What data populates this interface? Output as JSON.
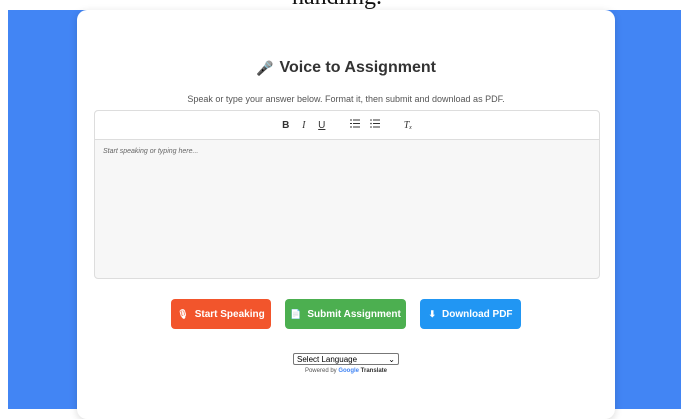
{
  "top_strip_text": "handling.",
  "app": {
    "title": "Voice to Assignment",
    "subtitle": "Speak or type your answer below. Format it, then submit and download as PDF.",
    "title_icon": "microphone-icon"
  },
  "toolbar": {
    "bold": "B",
    "italic": "I",
    "underline": "U",
    "ordered_list": "☰",
    "bullet_list": "☰",
    "clean": "Tₓ"
  },
  "editor": {
    "placeholder": "Start speaking or typing here..."
  },
  "buttons": {
    "start_speaking": "Start Speaking",
    "submit": "Submit Assignment",
    "download": "Download PDF"
  },
  "colors": {
    "background": "#4285f4",
    "start_speaking": "#f2552c",
    "submit": "#4caf50",
    "download": "#2196f3"
  },
  "language": {
    "selected": "Select Language",
    "powered_by": "Powered by",
    "google": "Google",
    "translate": "Translate"
  }
}
